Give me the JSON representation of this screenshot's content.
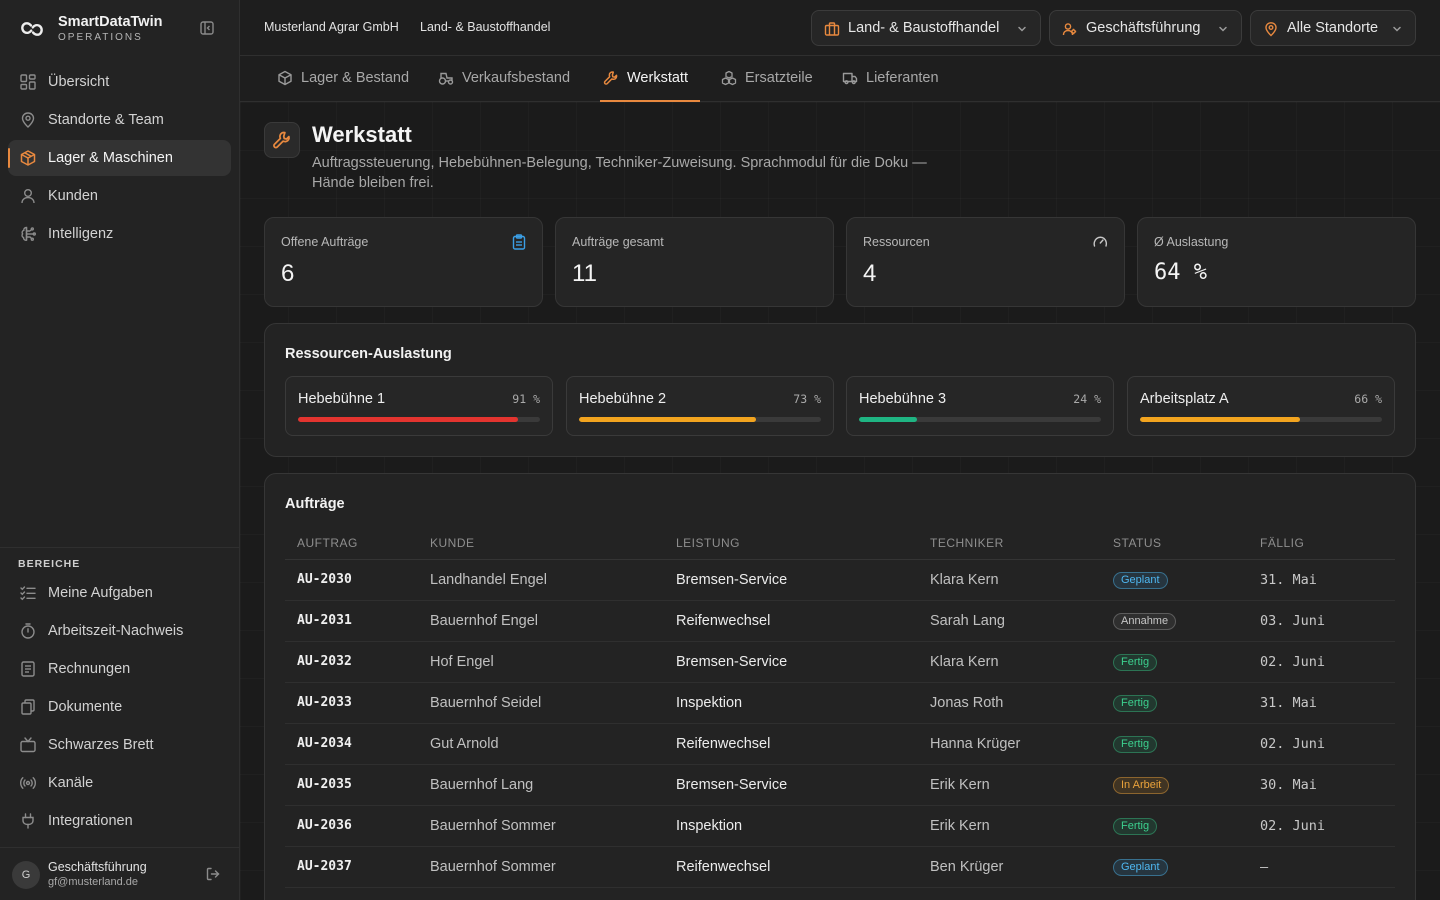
{
  "app": {
    "name": "SmartDataTwin",
    "subtitle": "OPERATIONS"
  },
  "sidebar": {
    "main_items": [
      {
        "label": "Übersicht",
        "icon": "grid-icon"
      },
      {
        "label": "Standorte & Team",
        "icon": "map-pin-icon"
      },
      {
        "label": "Lager & Maschinen",
        "icon": "package-icon",
        "active": true
      },
      {
        "label": "Kunden",
        "icon": "user-icon"
      },
      {
        "label": "Intelligenz",
        "icon": "brain-icon"
      }
    ],
    "section_label": "BEREICHE",
    "section_items": [
      {
        "label": "Meine Aufgaben",
        "icon": "list-checks-icon"
      },
      {
        "label": "Arbeitszeit-Nachweis",
        "icon": "stopwatch-icon"
      },
      {
        "label": "Rechnungen",
        "icon": "receipt-icon"
      },
      {
        "label": "Dokumente",
        "icon": "files-icon"
      },
      {
        "label": "Schwarzes Brett",
        "icon": "tv-icon"
      },
      {
        "label": "Kanäle",
        "icon": "radio-icon"
      },
      {
        "label": "Integrationen",
        "icon": "plug-icon"
      }
    ],
    "user": {
      "initial": "G",
      "name": "Geschäftsführung",
      "email": "gf@musterland.de"
    }
  },
  "topbar": {
    "company": "Musterland Agrar GmbH",
    "division": "Land- & Baustoffhandel",
    "dropdowns": {
      "branch": "Land- & Baustoffhandel",
      "role": "Geschäftsführung",
      "site": "Alle Standorte"
    }
  },
  "tabs": [
    {
      "label": "Lager & Bestand"
    },
    {
      "label": "Verkaufsbestand"
    },
    {
      "label": "Werkstatt",
      "active": true
    },
    {
      "label": "Ersatzteile"
    },
    {
      "label": "Lieferanten"
    }
  ],
  "page": {
    "title": "Werkstatt",
    "description": "Auftragssteuerung, Hebebühnen-Belegung, Techniker-Zuweisung. Sprachmodul für die Doku — Hände bleiben frei."
  },
  "kpis": [
    {
      "label": "Offene Aufträge",
      "value": "6",
      "icon": "clipboard-icon",
      "icon_color": "#3b9fe6"
    },
    {
      "label": "Aufträge gesamt",
      "value": "11"
    },
    {
      "label": "Ressourcen",
      "value": "4",
      "icon": "gauge-icon",
      "icon_color": "#c8c8c8"
    },
    {
      "label": "Ø Auslastung",
      "value": "64 %"
    }
  ],
  "resources": {
    "title": "Ressourcen-Auslastung",
    "items": [
      {
        "name": "Hebebühne 1",
        "percent": 91,
        "percent_label": "91 %",
        "color": "#e3342f"
      },
      {
        "name": "Hebebühne 2",
        "percent": 73,
        "percent_label": "73 %",
        "color": "#f2a41f"
      },
      {
        "name": "Hebebühne 3",
        "percent": 24,
        "percent_label": "24 %",
        "color": "#1fb583"
      },
      {
        "name": "Arbeitsplatz A",
        "percent": 66,
        "percent_label": "66 %",
        "color": "#f2a41f"
      }
    ]
  },
  "orders": {
    "title": "Aufträge",
    "columns": [
      "Auftrag",
      "Kunde",
      "Leistung",
      "Techniker",
      "Status",
      "Fällig"
    ],
    "rows": [
      {
        "id": "AU-2030",
        "customer": "Landhandel Engel",
        "service": "Bremsen-Service",
        "technician": "Klara Kern",
        "status": "Geplant",
        "status_type": "planned",
        "due": "31. Mai"
      },
      {
        "id": "AU-2031",
        "customer": "Bauernhof Engel",
        "service": "Reifenwechsel",
        "technician": "Sarah Lang",
        "status": "Annahme",
        "status_type": "intake",
        "due": "03. Juni"
      },
      {
        "id": "AU-2032",
        "customer": "Hof Engel",
        "service": "Bremsen-Service",
        "technician": "Klara Kern",
        "status": "Fertig",
        "status_type": "done",
        "due": "02. Juni"
      },
      {
        "id": "AU-2033",
        "customer": "Bauernhof Seidel",
        "service": "Inspektion",
        "technician": "Jonas Roth",
        "status": "Fertig",
        "status_type": "done",
        "due": "31. Mai"
      },
      {
        "id": "AU-2034",
        "customer": "Gut Arnold",
        "service": "Reifenwechsel",
        "technician": "Hanna Krüger",
        "status": "Fertig",
        "status_type": "done",
        "due": "02. Juni"
      },
      {
        "id": "AU-2035",
        "customer": "Bauernhof Lang",
        "service": "Bremsen-Service",
        "technician": "Erik Kern",
        "status": "In Arbeit",
        "status_type": "progress",
        "due": "30. Mai"
      },
      {
        "id": "AU-2036",
        "customer": "Bauernhof Sommer",
        "service": "Inspektion",
        "technician": "Erik Kern",
        "status": "Fertig",
        "status_type": "done",
        "due": "02. Juni"
      },
      {
        "id": "AU-2037",
        "customer": "Bauernhof Sommer",
        "service": "Reifenwechsel",
        "technician": "Ben Krüger",
        "status": "Geplant",
        "status_type": "planned",
        "due": "—"
      }
    ]
  },
  "colors": {
    "accent": "#e8893f",
    "background": "#1b1b1b",
    "sidebar": "#232323",
    "panel": "#232323"
  }
}
